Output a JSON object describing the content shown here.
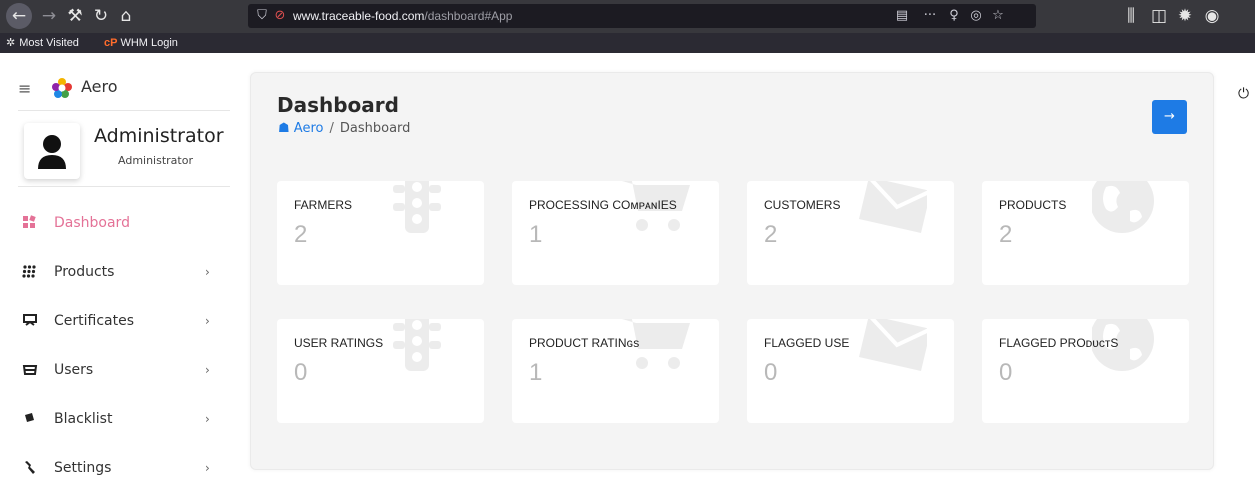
{
  "browser": {
    "url_domain": "www.traceable-food.com",
    "url_path": "/dashboard#App",
    "bookmarks": [
      {
        "label": "Most Visited",
        "icon": "gear-icon"
      },
      {
        "label": "WHM Login",
        "icon": "cpanel-icon"
      }
    ]
  },
  "sidebar": {
    "brand": "Aero",
    "user": {
      "name": "Administrator",
      "role": "Administrator"
    },
    "items": [
      {
        "label": "Dashboard",
        "icon": "dashboard-icon",
        "active": true,
        "has_submenu": false
      },
      {
        "label": "Products",
        "icon": "grid-icon",
        "active": false,
        "has_submenu": true
      },
      {
        "label": "Certificates",
        "icon": "certificate-icon",
        "active": false,
        "has_submenu": true
      },
      {
        "label": "Users",
        "icon": "users-icon",
        "active": false,
        "has_submenu": true
      },
      {
        "label": "Blacklist",
        "icon": "blacklist-icon",
        "active": false,
        "has_submenu": true
      },
      {
        "label": "Settings",
        "icon": "wrench-icon",
        "active": false,
        "has_submenu": true
      }
    ],
    "chevron": "›"
  },
  "main": {
    "title": "Dashboard",
    "breadcrumb": {
      "home": "Aero",
      "separator": "/",
      "current": "Dashboard"
    },
    "stats": [
      {
        "label": "FARMERS",
        "value": "2",
        "icon": "traffic-light-icon"
      },
      {
        "label": "PROCESSING COᴍᴘᴀɴIES",
        "value": "1",
        "icon": "cart-icon"
      },
      {
        "label": "CUSTOMERS",
        "value": "2",
        "icon": "envelope-icon"
      },
      {
        "label": "PRODUCTS",
        "value": "2",
        "icon": "globe-icon"
      },
      {
        "label": "USER RATINGS",
        "value": "0",
        "icon": "traffic-light-icon"
      },
      {
        "label": "PRODUCT RATINɢs",
        "value": "1",
        "icon": "cart-icon"
      },
      {
        "label": "FLAGGED USE",
        "value": "0",
        "icon": "envelope-icon"
      },
      {
        "label": "FLAGGED PROᴅᴜᴄᴛS",
        "value": "0",
        "icon": "globe-icon"
      }
    ]
  },
  "colors": {
    "accent": "#1e7be5",
    "active_nav": "#e47297",
    "card_bg": "#f4f4f4",
    "stat_value": "#b8b8b8"
  }
}
